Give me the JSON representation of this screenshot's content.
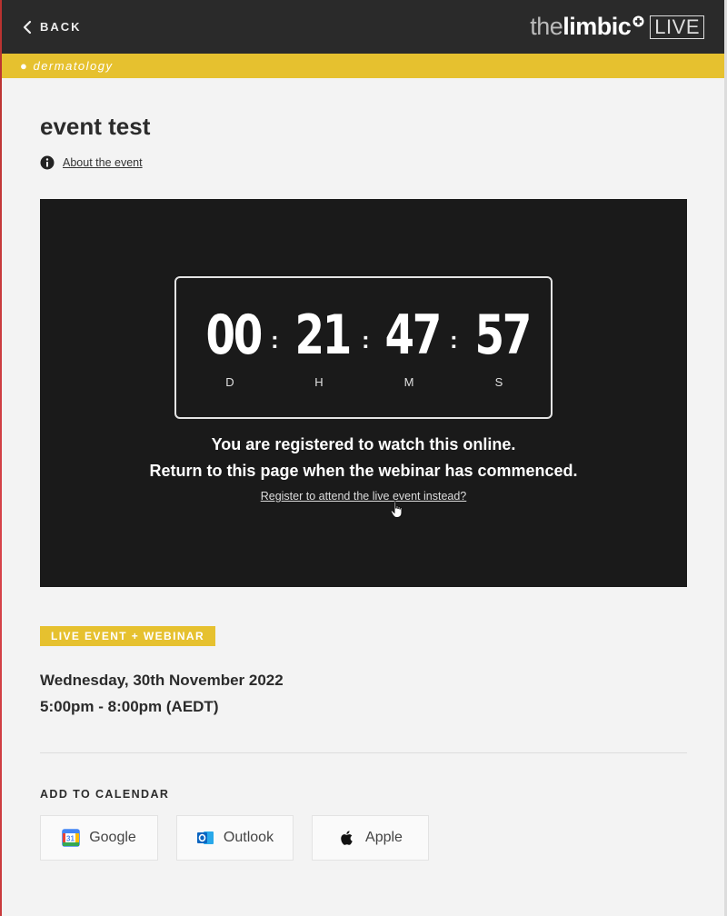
{
  "topbar": {
    "back_label": "BACK",
    "logo_the": "the",
    "logo_limbic": "limbic",
    "logo_live": "LIVE"
  },
  "category": "dermatology",
  "event": {
    "title": "event test",
    "about_link": "About the event"
  },
  "countdown": {
    "days": "00",
    "hours": "21",
    "minutes": "47",
    "seconds": "57",
    "day_label": "D",
    "hour_label": "H",
    "minute_label": "M",
    "second_label": "S",
    "separator": ":"
  },
  "registration": {
    "line1": "You are registered to watch this online.",
    "line2": "Return to this page when the webinar has commenced.",
    "link": "Register to attend the live event instead?"
  },
  "event_type_badge": "LIVE EVENT + WEBINAR",
  "schedule": {
    "date": "Wednesday, 30th November 2022",
    "time": "5:00pm - 8:00pm (AEDT)"
  },
  "calendar": {
    "heading": "ADD TO CALENDAR",
    "google": "Google",
    "outlook": "Outlook",
    "apple": "Apple"
  },
  "colors": {
    "accent_yellow": "#e6c12f",
    "topbar": "#2a2a2a",
    "video_bg": "#1a1a1a"
  }
}
